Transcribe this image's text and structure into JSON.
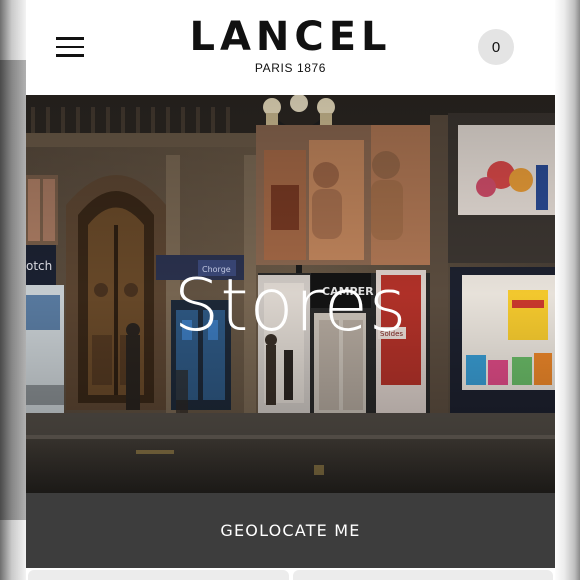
{
  "header": {
    "brand": "LANCEL",
    "brand_subtitle": "PARIS 1876",
    "cart_count": "0",
    "menu_icon": "hamburger-menu-icon"
  },
  "hero": {
    "title": "Stores",
    "storefront_signs": [
      "otch",
      "CAMPER",
      "Soldes",
      "Chorge"
    ]
  },
  "actions": {
    "geolocate_label": "GEOLOCATE ME"
  },
  "colors": {
    "header_bg": "#ffffff",
    "brand_text": "#111111",
    "cart_badge_bg": "#e4e4e4",
    "geolocate_bg": "#3d3d3d",
    "geolocate_text": "#ffffff"
  }
}
